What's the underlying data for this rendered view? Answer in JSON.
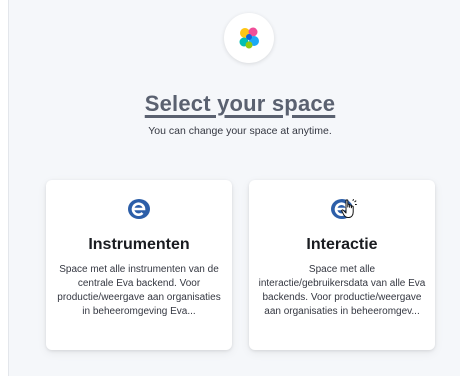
{
  "page": {
    "heading": "Select your space",
    "subheading": "You can change your space at anytime."
  },
  "logo": {
    "icon": "elastic-logo-icon"
  },
  "spaces": [
    {
      "icon": "space-e-avatar-icon",
      "title": "Instrumenten",
      "description": "Space met alle instrumenten van de centrale Eva backend. Voor productie/weergave aan organisaties in beheeromgeving Eva..."
    },
    {
      "icon": "space-e-avatar-icon",
      "title": "Interactie",
      "description": "Space met alle interactie/gebruikersdata van alle Eva backends. Voor productie/weergave aan organisaties in beheeromgev..."
    }
  ],
  "colors": {
    "avatar": "#2c5ea8",
    "heading": "#5a6170"
  }
}
